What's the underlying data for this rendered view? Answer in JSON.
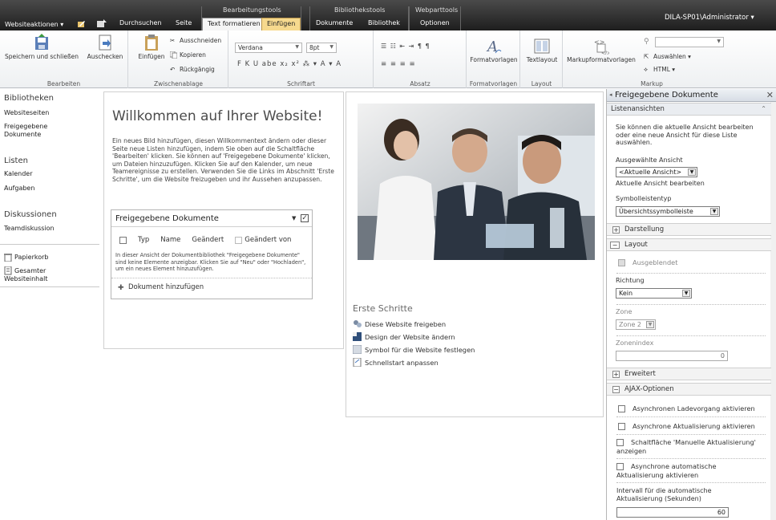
{
  "topbar": {
    "site_actions": "Websiteaktionen ▾",
    "tabs": [
      "Durchsuchen",
      "Seite",
      "Text formatieren",
      "Einfügen",
      "Dokumente",
      "Bibliothek",
      "Optionen"
    ],
    "ctx_groups": [
      "Bearbeitungstools",
      "Bibliothekstools",
      "Webparttools"
    ],
    "user": "DILA-SP01\\Administrator ▾"
  },
  "ribbon": {
    "save_close": "Speichern und schließen",
    "checkout": "Auschecken",
    "paste": "Einfügen",
    "cut": "Ausschneiden",
    "copy": "Kopieren",
    "undo": "Rückgängig",
    "font_family": "Verdana",
    "font_size": "8pt",
    "format_row": "F  K  U  abe  x₂  x²  ⁂ ▾  A ▾  A",
    "para_row1": "☰  ☷  ⇤  ⇥  ¶  ¶",
    "para_row2": "≡  ≡  ≡  ≡",
    "styles": "Formatvorlagen",
    "text_layout": "Textlayout",
    "markup_styles": "Markupformatvorlagen",
    "select": "Auswählen ▾",
    "html": "HTML ▾",
    "groups": [
      "Bearbeiten",
      "Zwischenablage",
      "Schriftart",
      "Absatz",
      "Formatvorlagen",
      "Layout",
      "Markup"
    ]
  },
  "leftnav": {
    "libraries": "Bibliotheken",
    "sitepages": "Websiteseiten",
    "shareddocs": "Freigegebene Dokumente",
    "lists": "Listen",
    "calendar": "Kalender",
    "tasks": "Aufgaben",
    "discussions": "Diskussionen",
    "teamdisc": "Teamdiskussion",
    "recycle": "Papierkorb",
    "allcontent": "Gesamter Websiteinhalt"
  },
  "content": {
    "title": "Willkommen auf Ihrer Website!",
    "intro": "Ein neues Bild hinzufügen, diesen Willkommentext ändern oder dieser Seite neue Listen hinzufügen, indem Sie oben auf die Schaltfläche 'Bearbeiten' klicken. Sie können auf 'Freigegebene Dokumente' klicken, um Dateien hinzuzufügen. Klicken Sie auf den Kalender, um neue Teamereignisse zu erstellen. Verwenden Sie die Links im Abschnitt 'Erste Schritte', um die Website freizugeben und ihr Aussehen anzupassen.",
    "docpart_title": "Freigegebene Dokumente",
    "col_type": "Typ",
    "col_name": "Name",
    "col_modified": "Geändert",
    "col_modified_by": "Geändert von",
    "empty_msg": "In dieser Ansicht der Dokumentbibliothek \"Freigegebene Dokumente\" sind keine Elemente anzeigbar. Klicken Sie auf \"Neu\" oder \"Hochladen\", um ein neues Element hinzuzufügen.",
    "add_doc": "Dokument hinzufügen",
    "steps_title": "Erste Schritte",
    "steps": [
      "Diese Website freigeben",
      "Design der Website ändern",
      "Symbol für die Website festlegen",
      "Schnellstart anpassen"
    ]
  },
  "toolpane": {
    "title": "Freigegebene Dokumente",
    "list_views": "Listenansichten",
    "desc": "Sie können die aktuelle Ansicht bearbeiten oder eine neue Ansicht für diese Liste auswählen.",
    "selected_view_label": "Ausgewählte Ansicht",
    "selected_view": "<Aktuelle Ansicht>",
    "edit_view": "Aktuelle Ansicht bearbeiten",
    "toolbar_type_label": "Symbolleistentyp",
    "toolbar_type": "Übersichtssymbolleiste",
    "appearance": "Darstellung",
    "layout": "Layout",
    "hidden": "Ausgeblendet",
    "direction_label": "Richtung",
    "direction": "Kein",
    "zone_label": "Zone",
    "zone": "Zone 2",
    "zoneindex_label": "Zonenindex",
    "zoneindex": "0",
    "advanced": "Erweitert",
    "ajax": "AJAX-Optionen",
    "ajax1": "Asynchronen Ladevorgang aktivieren",
    "ajax2": "Asynchrone Aktualisierung aktivieren",
    "ajax3": "Schaltfläche 'Manuelle Aktualisierung' anzeigen",
    "ajax4": "Asynchrone automatische Aktualisierung aktivieren",
    "interval_label": "Intervall für die automatische Aktualisierung (Sekunden)",
    "interval": "60"
  }
}
